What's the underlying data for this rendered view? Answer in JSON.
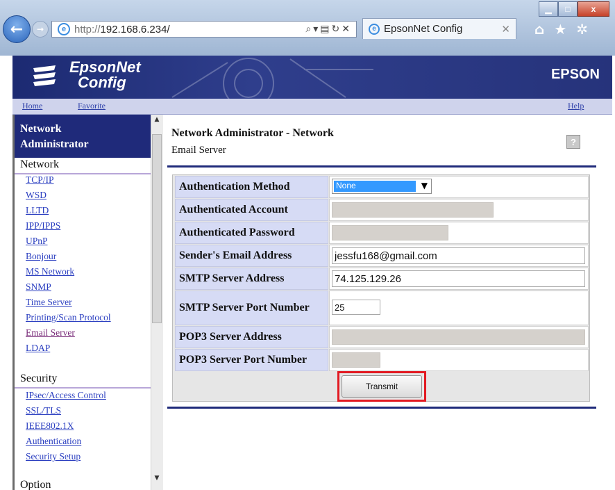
{
  "browser": {
    "url_prefix": "http://",
    "url_host": "192.168.6.234/",
    "tab_title": "EpsonNet Config",
    "window_minimize": "▁",
    "window_maximize": "□",
    "window_close": "x"
  },
  "header": {
    "logo_line1": "EpsonNet",
    "logo_line2": "Config",
    "brand": "EPSON"
  },
  "nav": {
    "home": "Home",
    "favorite": "Favorite",
    "help": "Help"
  },
  "sidebar": {
    "title_line1": "Network",
    "title_line2": "Administrator",
    "section_network": "Network",
    "network_links": [
      "TCP/IP",
      "WSD",
      "LLTD",
      "IPP/IPPS",
      "UPnP",
      "Bonjour",
      "MS Network",
      "SNMP",
      "Time Server",
      "Printing/Scan Protocol",
      "Email Server",
      "LDAP"
    ],
    "section_security": "Security",
    "security_links": [
      "IPsec/Access Control",
      "SSL/TLS",
      "IEEE802.1X",
      "Authentication",
      "Security Setup"
    ],
    "section_option": "Option"
  },
  "main": {
    "title": "Network Administrator - Network",
    "subtitle": "Email Server",
    "help_icon": "?",
    "fields": {
      "auth_method_label": "Authentication Method",
      "auth_method_value": "None",
      "auth_account_label": "Authenticated Account",
      "auth_password_label": "Authenticated Password",
      "sender_label": "Sender's Email Address",
      "sender_value": "jessfu168@gmail.com",
      "smtp_addr_label": "SMTP Server Address",
      "smtp_addr_value": "74.125.129.26",
      "smtp_port_label": "SMTP Server Port Number",
      "smtp_port_value": "25",
      "pop3_addr_label": "POP3 Server Address",
      "pop3_port_label": "POP3 Server Port Number"
    },
    "transmit": "Transmit"
  }
}
